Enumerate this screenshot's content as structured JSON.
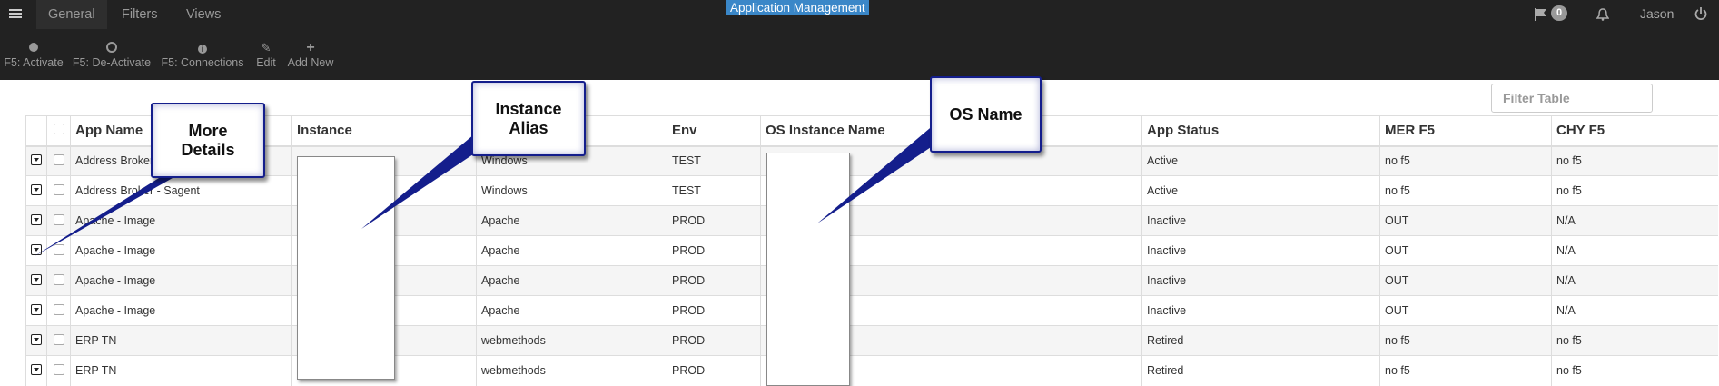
{
  "nav": {
    "tabs": [
      {
        "label": "General",
        "active": true
      },
      {
        "label": "Filters",
        "active": false
      },
      {
        "label": "Views",
        "active": false
      }
    ],
    "app_title": "Application Management",
    "notification_count": "0",
    "user": "Jason"
  },
  "toolbar": {
    "buttons": [
      {
        "label": "F5: Activate",
        "icon": "circle-filled-icon"
      },
      {
        "label": "F5: De-Activate",
        "icon": "circle-hollow-icon"
      },
      {
        "label": "F5: Connections",
        "icon": "info-circle-icon"
      },
      {
        "label": "Edit",
        "icon": "edit-icon"
      },
      {
        "label": "Add New",
        "icon": "plus-icon"
      }
    ]
  },
  "filter": {
    "placeholder": "Filter Table"
  },
  "table": {
    "headers": [
      "App Name",
      "Instance",
      "",
      "Env",
      "OS Instance Name",
      "App Status",
      "MER F5",
      "CHY F5"
    ],
    "rows": [
      [
        "Address Broker",
        "",
        "Windows",
        "TEST",
        "",
        "Active",
        "no f5",
        "no f5"
      ],
      [
        "Address Broker - Sagent",
        "",
        "Windows",
        "TEST",
        "",
        "Active",
        "no f5",
        "no f5"
      ],
      [
        "Apache - Image",
        "",
        "Apache",
        "PROD",
        "",
        "Inactive",
        "OUT",
        "N/A"
      ],
      [
        "Apache - Image",
        "",
        "Apache",
        "PROD",
        "",
        "Inactive",
        "OUT",
        "N/A"
      ],
      [
        "Apache - Image",
        "",
        "Apache",
        "PROD",
        "",
        "Inactive",
        "OUT",
        "N/A"
      ],
      [
        "Apache - Image",
        "",
        "Apache",
        "PROD",
        "",
        "Inactive",
        "OUT",
        "N/A"
      ],
      [
        "ERP TN",
        "",
        "webmethods",
        "PROD",
        "",
        "Retired",
        "no f5",
        "no f5"
      ],
      [
        "ERP TN",
        "",
        "webmethods",
        "PROD",
        "",
        "Retired",
        "no f5",
        "no f5"
      ]
    ]
  },
  "annotations": {
    "more_details": "More Details",
    "instance_alias": "Instance Alias",
    "os_name": "OS Name"
  },
  "colors": {
    "topbar": "#222222",
    "title_bg": "#3a87c8",
    "callout_border": "#141e8c"
  }
}
